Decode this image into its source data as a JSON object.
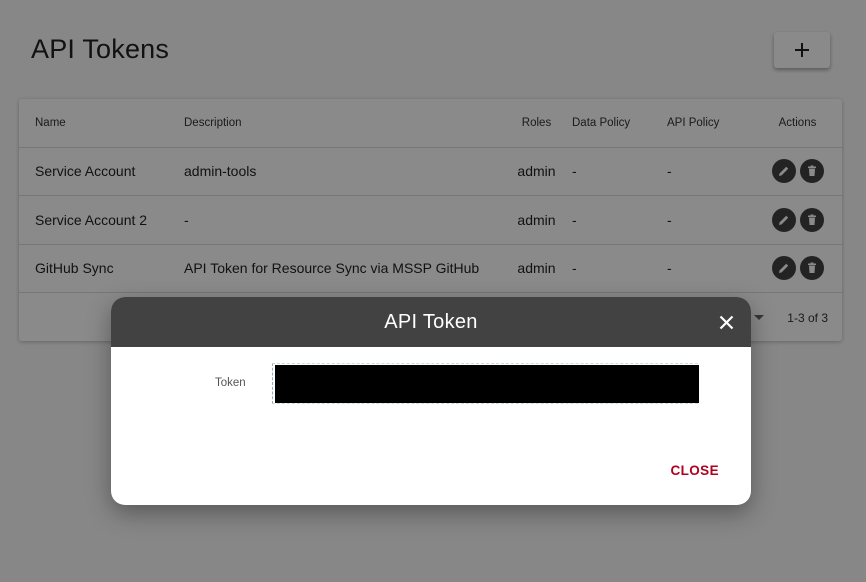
{
  "page": {
    "title": "API Tokens",
    "add_icon": "plus-icon"
  },
  "table": {
    "headers": [
      "Name",
      "Description",
      "Roles",
      "Data Policy",
      "API Policy",
      "Actions"
    ],
    "rows": [
      {
        "name": "Service Account",
        "description": "admin-tools",
        "roles": "admin",
        "data_policy": "-",
        "api_policy": "-"
      },
      {
        "name": "Service Account 2",
        "description": "-",
        "roles": "admin",
        "data_policy": "-",
        "api_policy": "-"
      },
      {
        "name": "GitHub Sync",
        "description": "API Token for Resource Sync via MSSP GitHub",
        "roles": "admin",
        "data_policy": "-",
        "api_policy": "-"
      }
    ],
    "pagination": "1-3 of 3"
  },
  "dialog": {
    "title": "API Token",
    "token_label": "Token",
    "token_value": "",
    "close_label": "CLOSE"
  },
  "colors": {
    "dialog_header": "#424242",
    "close_action": "#b00020",
    "icon_button": "#424242"
  }
}
